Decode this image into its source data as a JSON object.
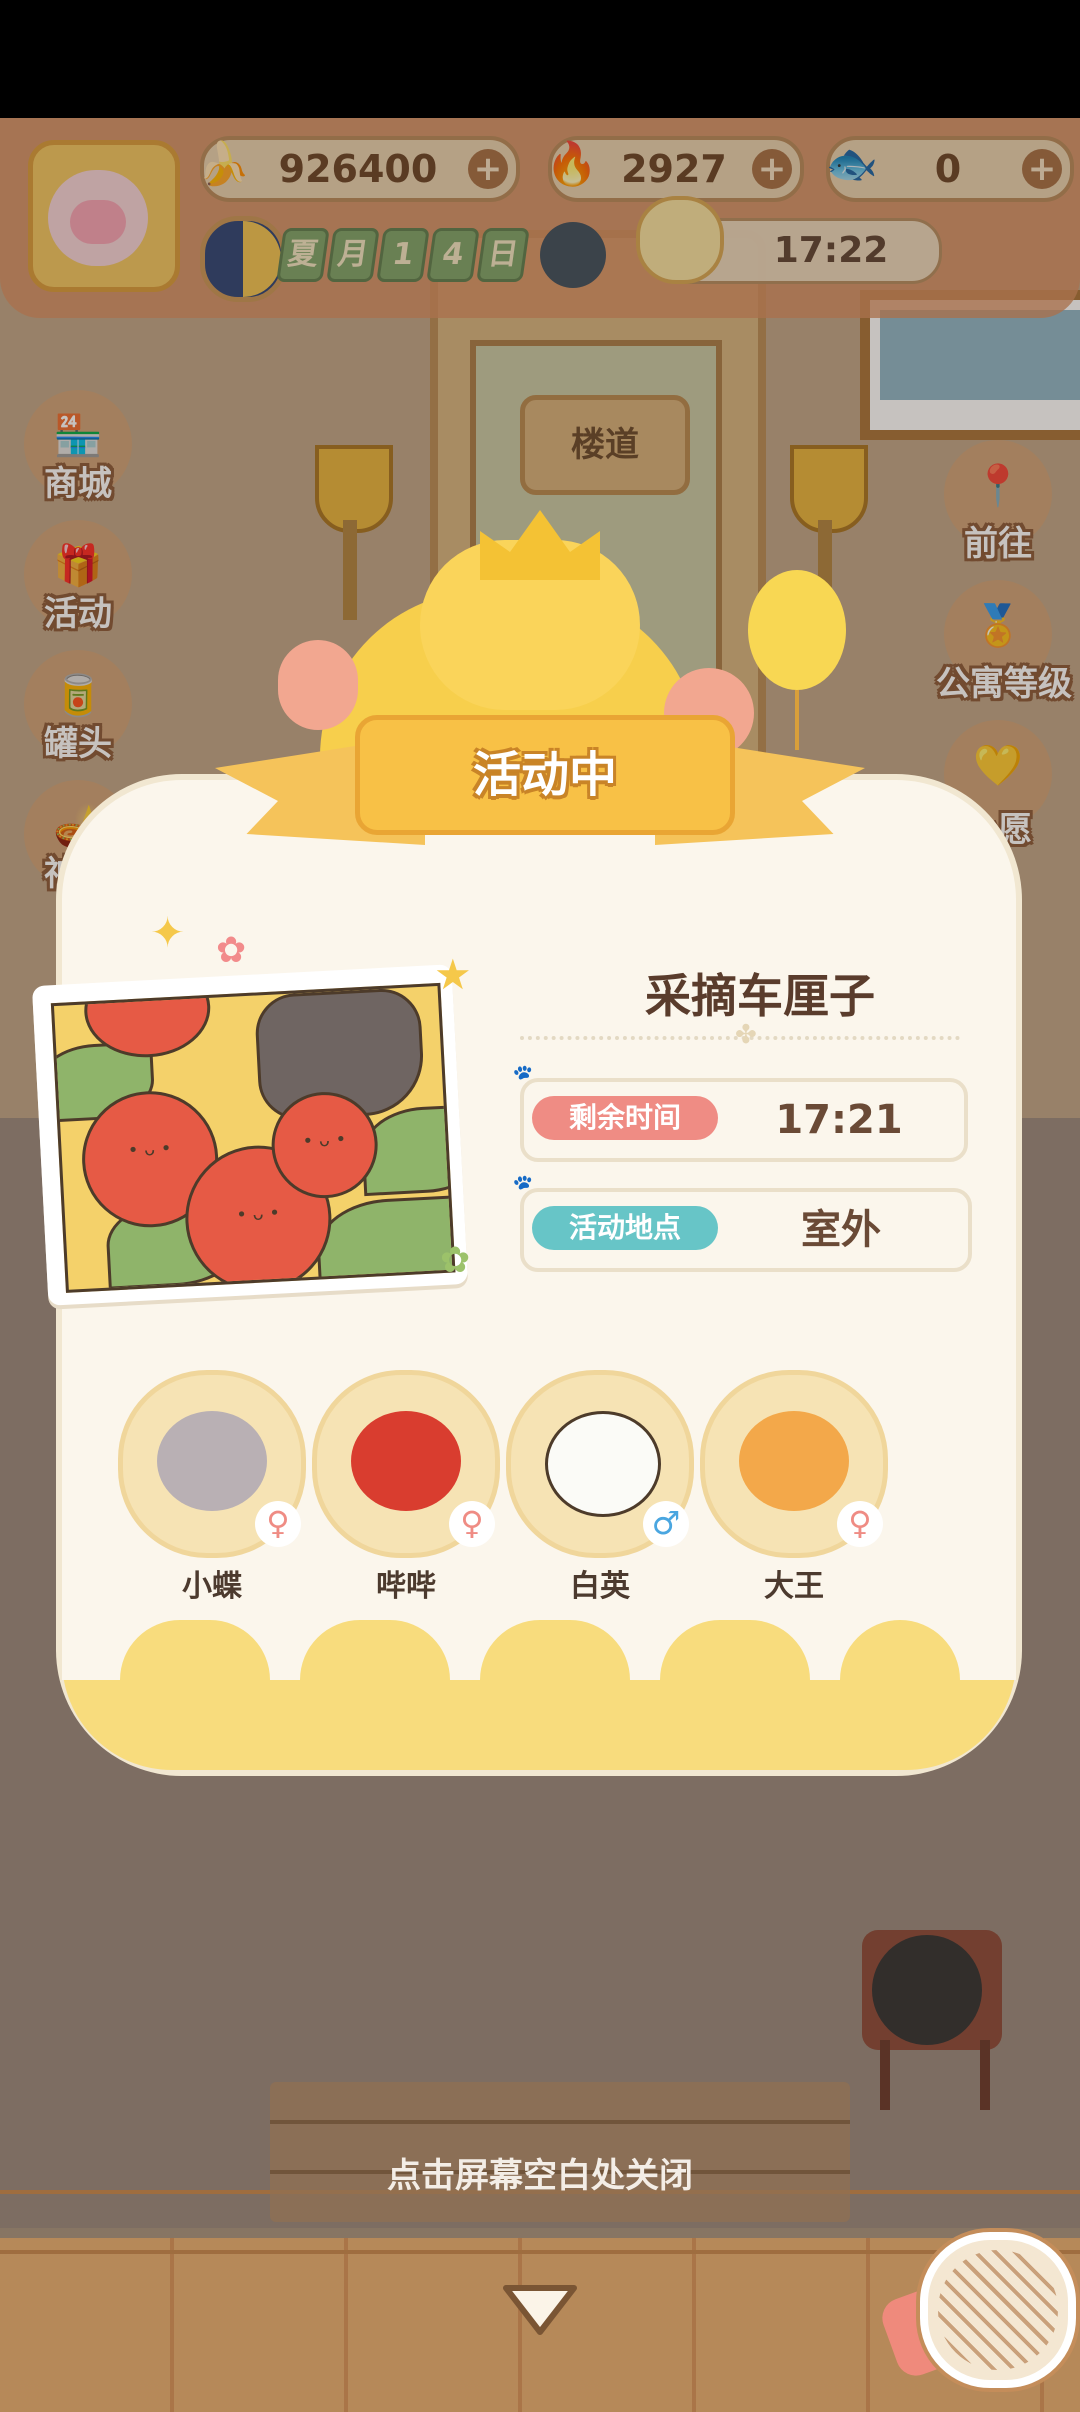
{
  "hud": {
    "bananas": "926400",
    "flames": "2927",
    "fish": "0",
    "date_chars": [
      "夏",
      "月",
      "1",
      "4",
      "日"
    ],
    "time": "17:22",
    "plus": "+"
  },
  "scene": {
    "door_sign": "楼道"
  },
  "left_menu": [
    {
      "label": "商城",
      "icon": "shop-icon",
      "glyph": "🏪"
    },
    {
      "label": "活动",
      "icon": "gift-icon",
      "glyph": "🎁"
    },
    {
      "label": "罐头",
      "icon": "can-icon",
      "glyph": "🥫"
    },
    {
      "label": "神灯",
      "icon": "magic-lamp-icon",
      "glyph": "🪔"
    }
  ],
  "right_menu": [
    {
      "label": "前往",
      "icon": "map-pin-icon",
      "glyph": "📍"
    },
    {
      "label": "公寓等级",
      "icon": "cat-medal-icon",
      "glyph": "🏅"
    },
    {
      "label": "心愿",
      "icon": "heart-book-icon",
      "glyph": "💛"
    }
  ],
  "modal": {
    "banner": "活动中",
    "event_name": "采摘车厘子",
    "remaining_time_label": "剩余时间",
    "remaining_time_value": "17:21",
    "location_label": "活动地点",
    "location_value": "室外",
    "pets": [
      {
        "name": "小蝶",
        "gender": "female",
        "gender_glyph": "♀",
        "face": "grey-snail-face"
      },
      {
        "name": "哔哔",
        "gender": "female",
        "gender_glyph": "♀",
        "face": "red-chick-face"
      },
      {
        "name": "白英",
        "gender": "male",
        "gender_glyph": "♂",
        "face": "white-eagle-face"
      },
      {
        "name": "大王",
        "gender": "female",
        "gender_glyph": "♀",
        "face": "tiger-face"
      }
    ]
  },
  "footer": {
    "close_hint": "点击屏幕空白处关闭"
  },
  "colors": {
    "tag_red": "#ef8c84",
    "tag_teal": "#67c5c7",
    "female": "#ef8c84",
    "male": "#4aa6e0"
  }
}
